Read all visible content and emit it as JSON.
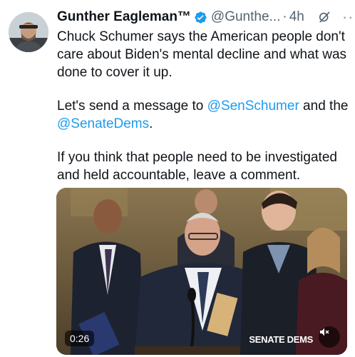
{
  "tweet": {
    "author_name": "Gunther Eagleman™",
    "handle": "@Gunthe...",
    "separator": "·",
    "time": "4h",
    "more": "···",
    "paragraphs": {
      "p1": "Chuck Schumer says the American people don't care about Biden's mental decline and what was done to cover it up.",
      "p2_prefix": "Let's send a message to ",
      "p2_mention1": "@SenSchumer",
      "p2_middle": " and the ",
      "p2_mention2": "@SenateDems",
      "p2_suffix": ".",
      "p3": "If you think that people need to be investigated and held accountable, leave a comment."
    }
  },
  "media": {
    "duration": "0:26",
    "brand_label": "SENATE DEMS"
  },
  "colors": {
    "accent": "#1d9bf0",
    "text": "#0f1419",
    "muted": "#536471"
  },
  "icons": [
    "verified-badge-icon",
    "grok-icon",
    "more-icon",
    "mute-icon"
  ]
}
